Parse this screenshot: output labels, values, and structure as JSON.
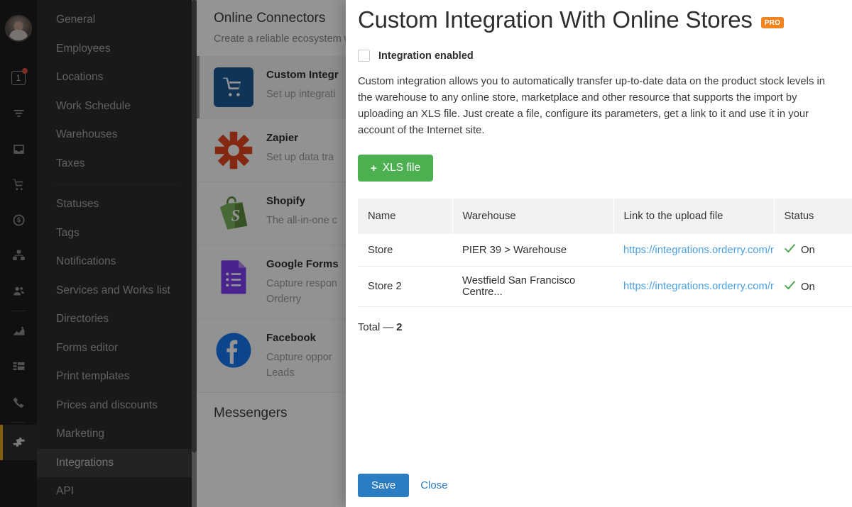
{
  "rail": {
    "avatar_name": "user-avatar",
    "items": [
      {
        "name": "tasks-icon",
        "badge": "1",
        "has_dot": true
      },
      {
        "name": "funnel-icon"
      },
      {
        "name": "inbox-icon"
      },
      {
        "name": "cart-icon"
      },
      {
        "name": "finance-icon"
      },
      {
        "name": "warehouse-icon"
      },
      {
        "name": "clients-icon"
      },
      {
        "name": "reports-icon"
      },
      {
        "name": "table-icon"
      },
      {
        "name": "phone-icon"
      },
      {
        "name": "settings-gear-icon",
        "active": true
      }
    ]
  },
  "settings_menu": {
    "items": [
      {
        "label": "General"
      },
      {
        "label": "Employees"
      },
      {
        "label": "Locations"
      },
      {
        "label": "Work Schedule"
      },
      {
        "label": "Warehouses"
      },
      {
        "label": "Taxes"
      },
      {
        "label": "Statuses"
      },
      {
        "label": "Tags"
      },
      {
        "label": "Notifications"
      },
      {
        "label": "Services and Works list"
      },
      {
        "label": "Directories"
      },
      {
        "label": "Forms editor"
      },
      {
        "label": "Print templates"
      },
      {
        "label": "Prices and discounts"
      },
      {
        "label": "Marketing"
      },
      {
        "label": "Integrations",
        "active": true
      },
      {
        "label": "API"
      }
    ]
  },
  "background": {
    "section_title": "Online Connectors",
    "section_subtitle": "Create a reliable ecosystem w",
    "messengers_title": "Messengers",
    "connectors": [
      {
        "name": "Custom Integr",
        "desc": "Set up integrati",
        "icon": "shopping-cart-icon",
        "selected": true
      },
      {
        "name": "Zapier",
        "desc": "Set up data tra",
        "icon": "zapier-icon",
        "selected": false
      },
      {
        "name": "Shopify",
        "desc": "The all-in-one c",
        "icon": "shopify-icon",
        "selected": false
      },
      {
        "name": "Google Forms",
        "desc": "Capture respon\nOrderry",
        "icon": "google-forms-icon",
        "selected": false
      },
      {
        "name": "Facebook",
        "desc": "Capture oppor\nLeads",
        "icon": "facebook-icon",
        "selected": false
      }
    ]
  },
  "modal": {
    "title": "Custom Integration With Online Stores",
    "pro_badge": "PRO",
    "enabled_label": "Integration enabled",
    "enabled_checked": false,
    "description": "Custom integration allows you to automatically transfer up-to-date data on the product stock levels in the warehouse to any online store, marketplace and other resource that supports the import by uploading an XLS file. Just create a file, configure its parameters, get a link to it and use it in your account of the Internet site.",
    "xls_button": {
      "plus": "+",
      "label": "XLS file"
    },
    "table": {
      "columns": [
        "Name",
        "Warehouse",
        "Link to the upload file",
        "Status"
      ],
      "rows": [
        {
          "name": "Store",
          "warehouse": "PIER 39 > Warehouse",
          "link": "https://integrations.orderry.com/n",
          "status": "On"
        },
        {
          "name": "Store 2",
          "warehouse": "Westfield San Francisco Centre...",
          "link": "https://integrations.orderry.com/n",
          "status": "On"
        }
      ]
    },
    "total_label": "Total —",
    "total_value": "2",
    "save_label": "Save",
    "close_label": "Close"
  },
  "colors": {
    "accent_green": "#4caf50",
    "accent_blue": "#2b7cc0",
    "link_blue": "#4a9fe0",
    "pro_orange": "#f08521",
    "rail_active": "#e8a317",
    "status_green": "#43a047"
  }
}
